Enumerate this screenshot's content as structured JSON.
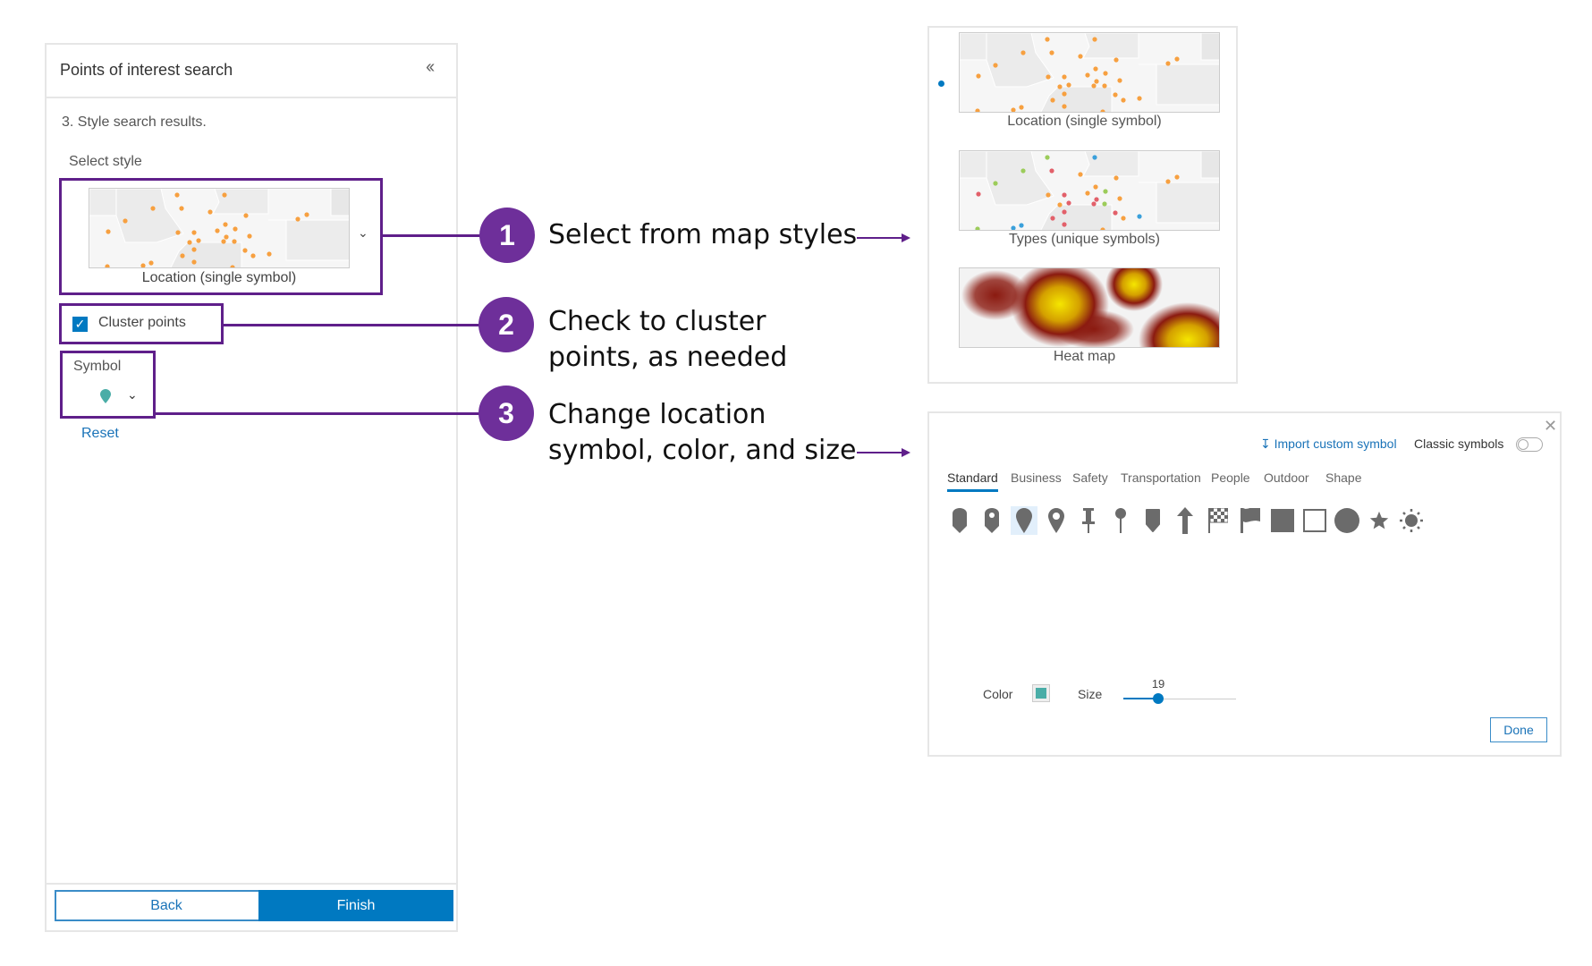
{
  "panel": {
    "title": "Points of interest search",
    "collapse_icon": "double-chevron-left",
    "step": "3.  Style search results.",
    "select_style_label": "Select style",
    "selected_style": "Location (single symbol)",
    "cluster_label": "Cluster points",
    "cluster_checked": true,
    "symbol_label": "Symbol",
    "symbol_color": "#4aada7",
    "reset_label": "Reset",
    "back_label": "Back",
    "finish_label": "Finish"
  },
  "callouts": [
    {
      "number": "1",
      "line1": "Select from map styles",
      "line2": ""
    },
    {
      "number": "2",
      "line1": "Check to cluster",
      "line2": "points, as needed"
    },
    {
      "number": "3",
      "line1": "Change location",
      "line2": "symbol, color, and size"
    }
  ],
  "styles": [
    {
      "caption": "Location (single symbol)"
    },
    {
      "caption": "Types (unique symbols)"
    },
    {
      "caption": "Heat map"
    }
  ],
  "dialog": {
    "import_label": "Import custom symbol",
    "classic_label": "Classic symbols",
    "classic_on": false,
    "tabs": [
      "Standard",
      "Business",
      "Safety",
      "Transportation",
      "People",
      "Outdoor",
      "Shape"
    ],
    "active_tab": "Standard",
    "symbols": [
      "pill-marker",
      "pill-marker-hole",
      "teardrop-pin",
      "location-pin-hole",
      "push-pin",
      "round-pin",
      "callout-marker",
      "arrow-up",
      "checkered-flag",
      "flag",
      "filled-square",
      "outline-square",
      "filled-circle",
      "star",
      "sun"
    ],
    "selected_symbol": "teardrop-pin",
    "color_label": "Color",
    "color_value": "#4aada7",
    "size_label": "Size",
    "size_value": "19",
    "size_fraction": 0.31,
    "done_label": "Done"
  },
  "colors": {
    "accent": "#0079c1",
    "callout_purple": "#6e2f9a",
    "highlight_border": "#5f1f8a",
    "point_orange": "#f7a040",
    "point_red": "#e2606a",
    "point_green": "#9ccc5a",
    "point_blue": "#3aa0db"
  }
}
